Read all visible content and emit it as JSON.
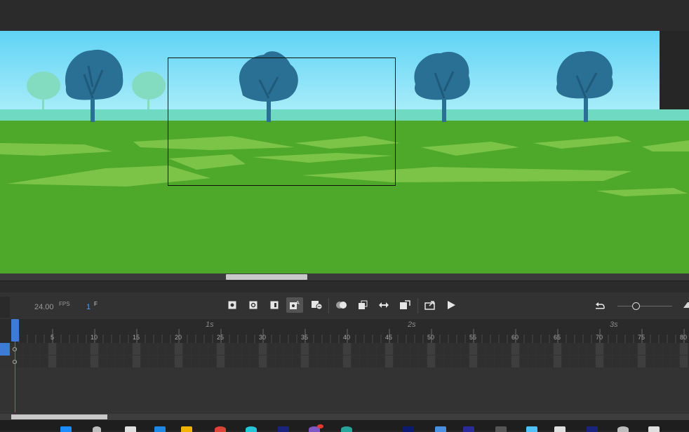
{
  "timeline": {
    "fps_value": "24.00",
    "fps_unit": "FPS",
    "frame_value": "1",
    "frame_unit": "F",
    "seconds_labels": [
      "1s",
      "2s",
      "3s"
    ],
    "frame_labels": [
      "5",
      "10",
      "15",
      "20",
      "25",
      "30",
      "35",
      "40",
      "45",
      "50",
      "55",
      "60",
      "65",
      "70",
      "75",
      "80"
    ]
  },
  "toolbar_icons": [
    "insert-keyframe-icon",
    "insert-blank-keyframe-icon",
    "insert-frame-icon",
    "auto-keyframe-icon",
    "remove-frame-icon",
    "onion-skin-icon",
    "edit-multiple-frames-icon",
    "loop-icon",
    "create-tween-icon",
    "export-icon",
    "play-icon",
    "undo-icon",
    "zoom-slider"
  ],
  "colors": {
    "sky_top": "#5fd3f5",
    "sky_bottom": "#a7ecf9",
    "ground": "#4ea829",
    "grass_light": "#7cc447",
    "tree": "#2a6f94",
    "far_tree": "#84dcc0",
    "accent": "#3e7bd6"
  }
}
